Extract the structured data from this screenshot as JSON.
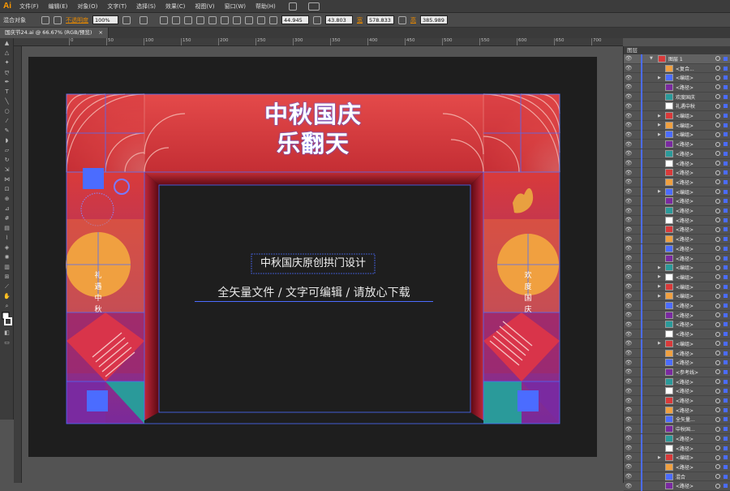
{
  "app": {
    "logo": "Ai"
  },
  "menu": [
    "文件(F)",
    "编辑(E)",
    "对象(O)",
    "文字(T)",
    "选择(S)",
    "效果(C)",
    "视图(V)",
    "窗口(W)",
    "帮助(H)"
  ],
  "control_bar": {
    "mode_label": "混合对象",
    "opacity_label": "不透明度",
    "opacity_value": "100%",
    "x_value": "44.945",
    "y_value": "43.803",
    "w_label": "宽",
    "w_value": "578.833",
    "h_label": "高",
    "h_value": "385.989"
  },
  "document_tab": {
    "title": "国庆节24.ai @ 66.67% (RGB/预览)",
    "close": "×"
  },
  "ruler_labels": [
    "0",
    "50",
    "100",
    "150",
    "200",
    "250",
    "300",
    "350",
    "400",
    "450",
    "500",
    "550",
    "600",
    "650",
    "700"
  ],
  "artwork": {
    "title_line1": "中秋国庆",
    "title_line2": "乐翻天",
    "subtitle": "中秋国庆原创拱门设计",
    "tagline": "全矢量文件 / 文字可编辑 / 请放心下载",
    "left_vertical": [
      "礼",
      "遇",
      "中",
      "秋"
    ],
    "right_vertical": [
      "欢",
      "度",
      "国",
      "庆"
    ],
    "colors": {
      "red": "#d93a3a",
      "dark_red": "#8a1020",
      "orange": "#f0a040",
      "blue": "#4b6cff",
      "purple": "#6a2aa0",
      "teal": "#2a9a9a"
    }
  },
  "layers_panel": {
    "title": "图层",
    "layers": [
      {
        "name": "图层 1",
        "expand": true,
        "top": true
      },
      {
        "name": "<复合...",
        "expand": false
      },
      {
        "name": "<编组>",
        "expand": true
      },
      {
        "name": "<路径>",
        "expand": false
      },
      {
        "name": "欢度国庆",
        "expand": false
      },
      {
        "name": "礼遇中秋",
        "expand": false
      },
      {
        "name": "<编组>",
        "expand": true
      },
      {
        "name": "<编组>",
        "expand": true
      },
      {
        "name": "<编组>",
        "expand": true
      },
      {
        "name": "<路径>",
        "expand": false
      },
      {
        "name": "<路径>",
        "expand": false
      },
      {
        "name": "<路径>",
        "expand": false
      },
      {
        "name": "<路径>",
        "expand": false
      },
      {
        "name": "<路径>",
        "expand": false
      },
      {
        "name": "<编组>",
        "expand": true
      },
      {
        "name": "<路径>",
        "expand": false
      },
      {
        "name": "<路径>",
        "expand": false
      },
      {
        "name": "<路径>",
        "expand": false
      },
      {
        "name": "<路径>",
        "expand": false
      },
      {
        "name": "<路径>",
        "expand": false
      },
      {
        "name": "<路径>",
        "expand": false
      },
      {
        "name": "<路径>",
        "expand": false
      },
      {
        "name": "<编组>",
        "expand": true
      },
      {
        "name": "<编组>",
        "expand": true
      },
      {
        "name": "<编组>",
        "expand": true
      },
      {
        "name": "<编组>",
        "expand": true
      },
      {
        "name": "<路径>",
        "expand": false
      },
      {
        "name": "<路径>",
        "expand": false
      },
      {
        "name": "<路径>",
        "expand": false
      },
      {
        "name": "<路径>",
        "expand": false
      },
      {
        "name": "<编组>",
        "expand": true
      },
      {
        "name": "<路径>",
        "expand": false
      },
      {
        "name": "<路径>",
        "expand": false
      },
      {
        "name": "<参考线>",
        "expand": false
      },
      {
        "name": "<路径>",
        "expand": false
      },
      {
        "name": "<路径>",
        "expand": false
      },
      {
        "name": "<路径>",
        "expand": false
      },
      {
        "name": "<路径>",
        "expand": false
      },
      {
        "name": "全矢量...",
        "expand": false
      },
      {
        "name": "中秋国...",
        "expand": false
      },
      {
        "name": "<路径>",
        "expand": false
      },
      {
        "name": "<路径>",
        "expand": false
      },
      {
        "name": "<编组>",
        "expand": true
      },
      {
        "name": "<路径>",
        "expand": false
      },
      {
        "name": "混合",
        "expand": false
      },
      {
        "name": "<路径>",
        "expand": false
      }
    ]
  }
}
